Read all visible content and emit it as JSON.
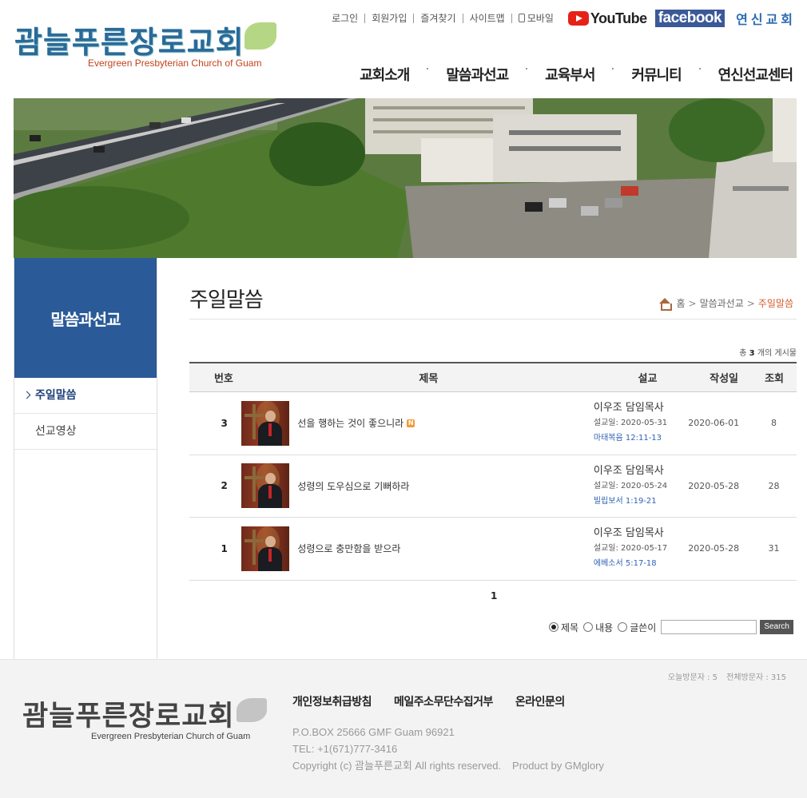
{
  "header": {
    "logo_ko": "괌늘푸른장로교회",
    "logo_en": "Evergreen Presbyterian Church of Guam",
    "utility": [
      "로그인",
      "회원가입",
      "즐겨찾기",
      "사이트맵"
    ],
    "mobile": "모바일",
    "youtube": "YouTube",
    "facebook": "facebook",
    "yeonsin": "연신교회",
    "gnb": [
      "교회소개",
      "말씀과선교",
      "교육부서",
      "커뮤니티",
      "연신선교센터"
    ]
  },
  "sidebar": {
    "title": "말씀과선교",
    "items": [
      {
        "label": "주일말씀",
        "active": true
      },
      {
        "label": "선교영상",
        "active": false
      }
    ]
  },
  "main": {
    "title": "주일말씀",
    "breadcrumb": [
      "홈",
      "말씀과선교",
      "주일말씀"
    ],
    "count_prefix": "총",
    "count": "3",
    "count_suffix": "개의 게시물",
    "columns": [
      "번호",
      "제목",
      "설교",
      "작성일",
      "조회"
    ],
    "rows": [
      {
        "no": "3",
        "title": "선을 행하는 것이 좋으니라",
        "new": true,
        "preacher": "이우조 담임목사",
        "sermon_date": "설교일: 2020-05-31",
        "verse": "마태복음 12:11-13",
        "date": "2020-06-01",
        "views": "8"
      },
      {
        "no": "2",
        "title": "성령의 도우심으로 기뻐하라",
        "new": false,
        "preacher": "이우조 담임목사",
        "sermon_date": "설교일: 2020-05-24",
        "verse": "빌립보서 1:19-21",
        "date": "2020-05-28",
        "views": "28"
      },
      {
        "no": "1",
        "title": "성령으로 충만함을 받으라",
        "new": false,
        "preacher": "이우조 담임목사",
        "sermon_date": "설교일: 2020-05-17",
        "verse": "에베소서 5:17-18",
        "date": "2020-05-28",
        "views": "31"
      }
    ],
    "new_icon": "N",
    "page": "1",
    "search": {
      "options": [
        "제목",
        "내용",
        "글쓴이"
      ],
      "selected": "제목",
      "button": "Search"
    }
  },
  "footer": {
    "logo_ko": "괌늘푸른장로교회",
    "logo_en": "Evergreen Presbyterian Church of Guam",
    "links": [
      "개인정보취급방침",
      "메일주소무단수집거부",
      "온라인문의"
    ],
    "address": "P.O.BOX 25666 GMF Guam 96921",
    "tel": "TEL: +1(671)777-3416",
    "copyright": "Copyright (c) 괌늘푸른교회 All rights reserved.",
    "product": "Product by GMglory",
    "visitors_today": "오늘방문자 : 5",
    "visitors_total": "전체방문자 : 315"
  }
}
